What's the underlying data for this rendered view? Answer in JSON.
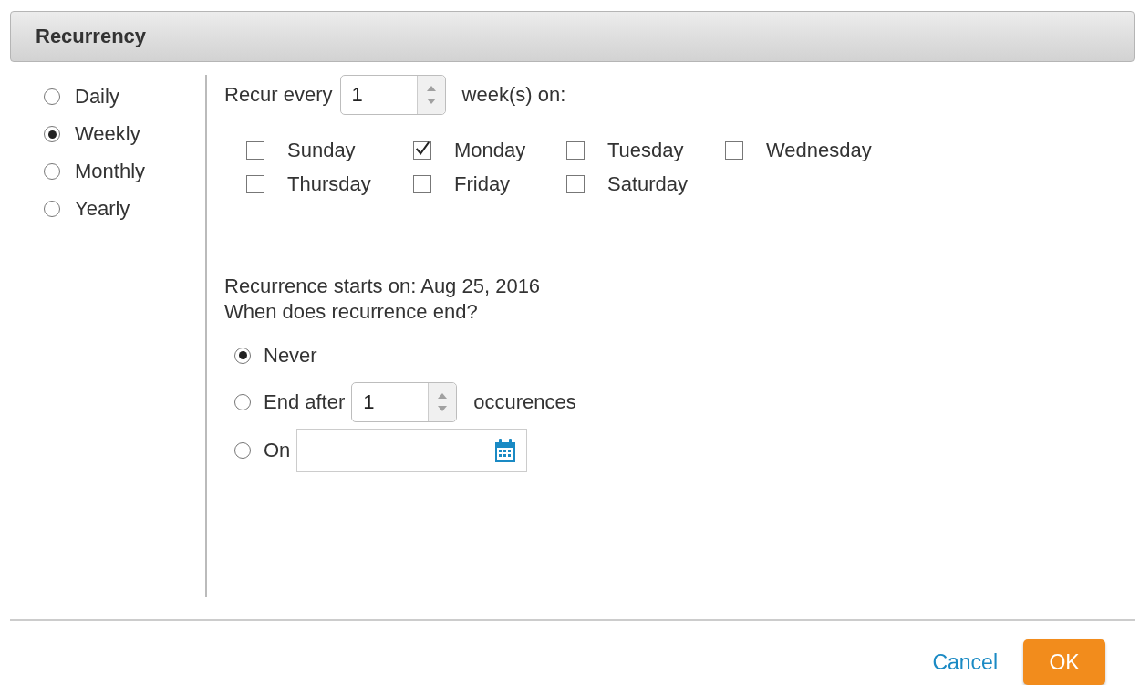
{
  "dialog": {
    "title": "Recurrency"
  },
  "patterns": [
    {
      "label": "Daily",
      "selected": false
    },
    {
      "label": "Weekly",
      "selected": true
    },
    {
      "label": "Monthly",
      "selected": false
    },
    {
      "label": "Yearly",
      "selected": false
    }
  ],
  "recur_every": {
    "prefix": "Recur every",
    "value": "1",
    "suffix": "week(s) on:"
  },
  "days": [
    {
      "label": "Sunday",
      "checked": false
    },
    {
      "label": "Monday",
      "checked": true
    },
    {
      "label": "Tuesday",
      "checked": false
    },
    {
      "label": "Wednesday",
      "checked": false
    },
    {
      "label": "Thursday",
      "checked": false
    },
    {
      "label": "Friday",
      "checked": false
    },
    {
      "label": "Saturday",
      "checked": false
    }
  ],
  "starts_on": "Recurrence starts on: Aug 25, 2016",
  "end_question": "When does recurrence end?",
  "end_options": [
    {
      "kind": "never",
      "label": "Never",
      "selected": true
    },
    {
      "kind": "after",
      "label": "End after",
      "value": "1",
      "suffix": "occurences",
      "selected": false
    },
    {
      "kind": "on",
      "label": "On",
      "selected": false
    }
  ],
  "buttons": {
    "cancel": "Cancel",
    "ok": "OK"
  }
}
